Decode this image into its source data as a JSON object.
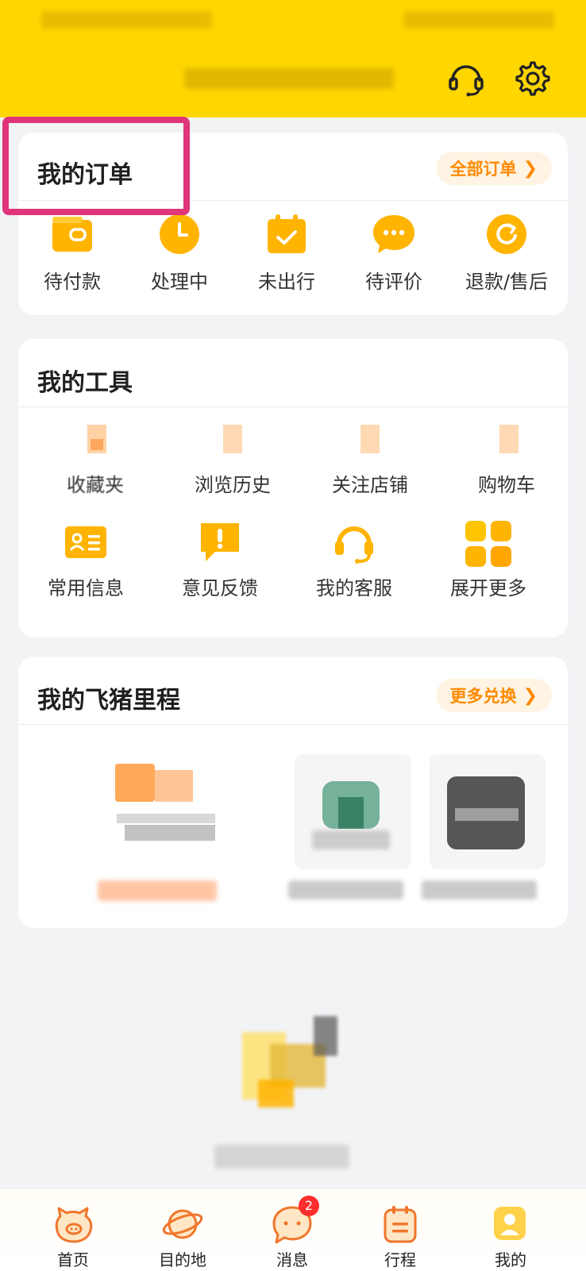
{
  "header": {
    "support_icon": "headset-icon",
    "settings_icon": "gear-icon"
  },
  "orders": {
    "title": "我的订单",
    "all_label": "全部订单",
    "items": [
      {
        "label": "待付款",
        "icon": "wallet-icon"
      },
      {
        "label": "处理中",
        "icon": "clock-icon"
      },
      {
        "label": "未出行",
        "icon": "calendar-check-icon"
      },
      {
        "label": "待评价",
        "icon": "chat-bubble-icon"
      },
      {
        "label": "退款/售后",
        "icon": "refund-icon"
      }
    ]
  },
  "tools": {
    "title": "我的工具",
    "items": [
      {
        "label": "收藏夹"
      },
      {
        "label": "浏览历史"
      },
      {
        "label": "关注店铺"
      },
      {
        "label": "购物车"
      },
      {
        "label": "常用信息",
        "icon": "id-card-icon"
      },
      {
        "label": "意见反馈",
        "icon": "feedback-icon"
      },
      {
        "label": "我的客服",
        "icon": "headset-icon"
      },
      {
        "label": "展开更多",
        "icon": "grid-icon"
      }
    ]
  },
  "mileage": {
    "title": "我的飞猪里程",
    "more_label": "更多兑换"
  },
  "tabbar": {
    "items": [
      {
        "label": "首页",
        "icon": "pig-icon"
      },
      {
        "label": "目的地",
        "icon": "planet-icon"
      },
      {
        "label": "消息",
        "icon": "message-icon",
        "badge": "2"
      },
      {
        "label": "行程",
        "icon": "itinerary-icon"
      },
      {
        "label": "我的",
        "icon": "profile-icon"
      }
    ]
  },
  "colors": {
    "header": "#ffd600",
    "accent": "#ff8a00",
    "icon_yellow": "#ffb400",
    "highlight": "#e0357a",
    "badge": "#ff2d2d"
  }
}
